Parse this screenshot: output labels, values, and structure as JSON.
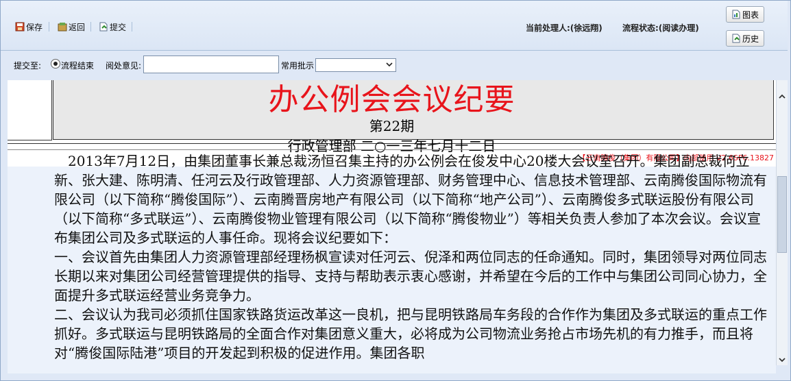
{
  "toolbar": {
    "save_label": "保存",
    "back_label": "返回",
    "submit_label": "提交",
    "handler": "当前处理人:(徐远翔)",
    "status": "流程状态:(阅读办理)",
    "chart_button": "图表",
    "history_button": "历史"
  },
  "submit_row": {
    "submit_to_label": "提交至:",
    "radio_label": "流程结束",
    "opinion_label": "阅处意见:",
    "opinion_value": "",
    "common_label": "常用批示",
    "common_value": ""
  },
  "document": {
    "title": "办公例会会议纪要",
    "issue": "第22期",
    "dept_date": "行政管理部 二○一三年七月十二日",
    "stamp": "【云南腾俊（集团）有限公司】内部使用 V2.6SP6.13827",
    "paragraphs": [
      "　2013年7月12日，由集团董事长兼总裁汤恒召集主持的办公例会在俊发中心20楼大会议室召开。集团副总裁何立新、张大建、陈明清、任河云及行政管理部、人力资源管理部、财务管理中心、信息技术管理部、云南腾俊国际物流有限公司（以下简称“腾俊国际”）、云南腾晋房地产有限公司（以下简称“地产公司”）、云南腾俊多式联运股份有限公司（以下简称“多式联运”）、云南腾俊物业管理有限公司（以下简称“腾俊物业”）等相关负责人参加了本次会议。会议宣布集团公司及多式联运的人事任命。现将会议纪要如下：",
      "一、会议首先由集团人力资源管理部经理杨枫宣读对任河云、倪泽和两位同志的任命通知。同时，集团领导对两位同志长期以来对集团公司经营管理提供的指导、支持与帮助表示衷心感谢，并希望在今后的工作中与集团公司同心协力，全面提升多式联运经营业务竞争力。",
      "二、会议认为我司必须抓住国家铁路货运改革这一良机，把与昆明铁路局车务段的合作作为集团及多式联运的重点工作抓好。多式联运与昆明铁路局的全面合作对集团意义重大，必将成为公司物流业务抢占市场先机的有力推手，而且将对“腾俊国际陆港”项目的开发起到积极的促进作用。集团各职"
    ]
  }
}
